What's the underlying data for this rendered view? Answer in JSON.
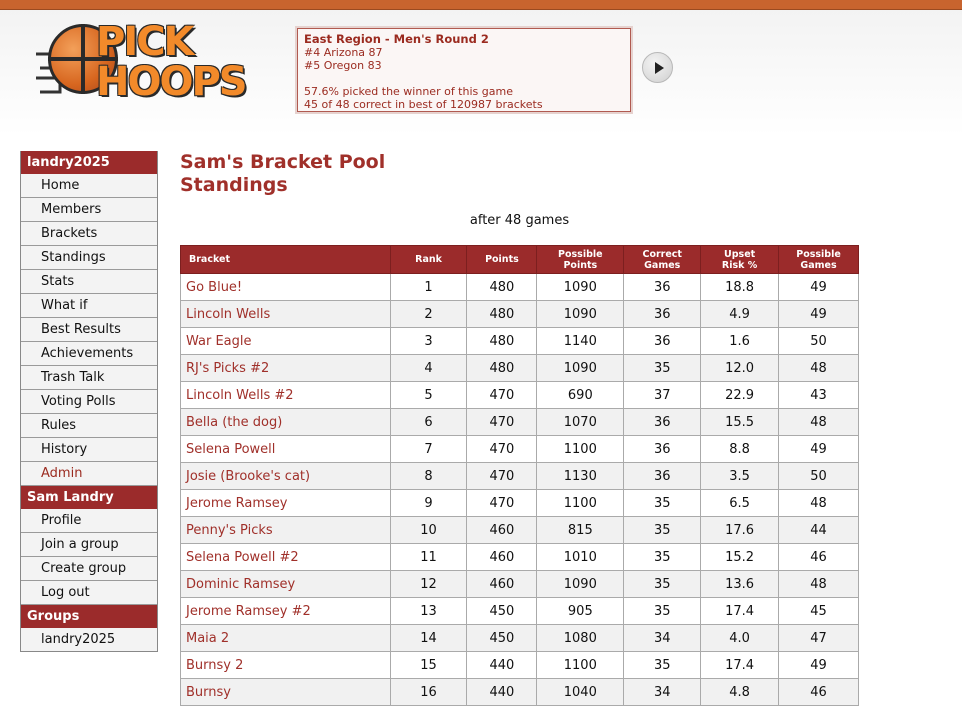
{
  "logo": {
    "line1": "PICK",
    "line2": "HOOPS"
  },
  "ticker": {
    "title": "East Region - Men's Round 2",
    "team1": "#4 Arizona 87",
    "team2": "#5 Oregon 83",
    "stat1": "57.6% picked the winner of this game",
    "stat2": "45 of 48 correct in best of 120987 brackets"
  },
  "sidebar": {
    "group_header": "landry2025",
    "group_items": [
      "Home",
      "Members",
      "Brackets",
      "Standings",
      "Stats",
      "What if",
      "Best Results",
      "Achievements",
      "Trash Talk",
      "Voting Polls",
      "Rules",
      "History",
      "Admin"
    ],
    "user_header": "Sam Landry",
    "user_items": [
      "Profile",
      "Join a group",
      "Create group",
      "Log out"
    ],
    "groups_header": "Groups",
    "groups_items": [
      "landry2025"
    ]
  },
  "main": {
    "title": "Sam's Bracket Pool Standings",
    "subtitle": "after 48 games"
  },
  "table": {
    "headers": {
      "bracket": "Bracket",
      "rank": "Rank",
      "points": "Points",
      "possible_points_1": "Possible",
      "possible_points_2": "Points",
      "correct_games_1": "Correct",
      "correct_games_2": "Games",
      "upset_risk_1": "Upset",
      "upset_risk_2": "Risk %",
      "possible_games_1": "Possible",
      "possible_games_2": "Games"
    },
    "rows": [
      {
        "bracket": "Go Blue!",
        "rank": "1",
        "points": "480",
        "possible_points": "1090",
        "correct_games": "36",
        "upset_risk": "18.8",
        "possible_games": "49"
      },
      {
        "bracket": "Lincoln Wells",
        "rank": "2",
        "points": "480",
        "possible_points": "1090",
        "correct_games": "36",
        "upset_risk": "4.9",
        "possible_games": "49"
      },
      {
        "bracket": "War Eagle",
        "rank": "3",
        "points": "480",
        "possible_points": "1140",
        "correct_games": "36",
        "upset_risk": "1.6",
        "possible_games": "50"
      },
      {
        "bracket": "RJ's Picks #2",
        "rank": "4",
        "points": "480",
        "possible_points": "1090",
        "correct_games": "35",
        "upset_risk": "12.0",
        "possible_games": "48"
      },
      {
        "bracket": "Lincoln Wells #2",
        "rank": "5",
        "points": "470",
        "possible_points": "690",
        "correct_games": "37",
        "upset_risk": "22.9",
        "possible_games": "43"
      },
      {
        "bracket": "Bella (the dog)",
        "rank": "6",
        "points": "470",
        "possible_points": "1070",
        "correct_games": "36",
        "upset_risk": "15.5",
        "possible_games": "48"
      },
      {
        "bracket": "Selena Powell",
        "rank": "7",
        "points": "470",
        "possible_points": "1100",
        "correct_games": "36",
        "upset_risk": "8.8",
        "possible_games": "49"
      },
      {
        "bracket": "Josie (Brooke's cat)",
        "rank": "8",
        "points": "470",
        "possible_points": "1130",
        "correct_games": "36",
        "upset_risk": "3.5",
        "possible_games": "50"
      },
      {
        "bracket": "Jerome Ramsey",
        "rank": "9",
        "points": "470",
        "possible_points": "1100",
        "correct_games": "35",
        "upset_risk": "6.5",
        "possible_games": "48"
      },
      {
        "bracket": "Penny's Picks",
        "rank": "10",
        "points": "460",
        "possible_points": "815",
        "correct_games": "35",
        "upset_risk": "17.6",
        "possible_games": "44"
      },
      {
        "bracket": "Selena Powell #2",
        "rank": "11",
        "points": "460",
        "possible_points": "1010",
        "correct_games": "35",
        "upset_risk": "15.2",
        "possible_games": "46"
      },
      {
        "bracket": "Dominic Ramsey",
        "rank": "12",
        "points": "460",
        "possible_points": "1090",
        "correct_games": "35",
        "upset_risk": "13.6",
        "possible_games": "48"
      },
      {
        "bracket": "Jerome Ramsey #2",
        "rank": "13",
        "points": "450",
        "possible_points": "905",
        "correct_games": "35",
        "upset_risk": "17.4",
        "possible_games": "45"
      },
      {
        "bracket": "Maia 2",
        "rank": "14",
        "points": "450",
        "possible_points": "1080",
        "correct_games": "34",
        "upset_risk": "4.0",
        "possible_games": "47"
      },
      {
        "bracket": "Burnsy 2",
        "rank": "15",
        "points": "440",
        "possible_points": "1100",
        "correct_games": "35",
        "upset_risk": "17.4",
        "possible_games": "49"
      },
      {
        "bracket": "Burnsy",
        "rank": "16",
        "points": "440",
        "possible_points": "1040",
        "correct_games": "34",
        "upset_risk": "4.8",
        "possible_games": "46"
      }
    ]
  },
  "colors": {
    "accent": "#9b2b2b",
    "link": "#a0302a",
    "stripe": "#c8642e"
  }
}
